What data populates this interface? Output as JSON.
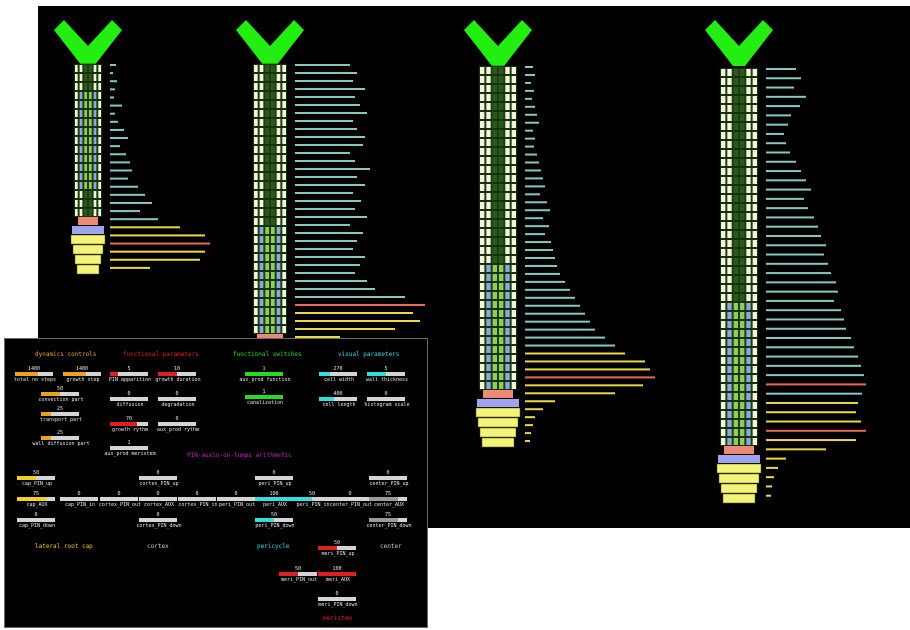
{
  "colors": {
    "sim_bg": "#000000",
    "v_tip": "#22ee11",
    "cell_fill": "#f2f7dc",
    "cell_green": "#8fcc5a",
    "cell_blue": "#8aa8dd",
    "cell_pink": "#ee8877",
    "meristem_band": "#a0a4ee",
    "cap": "#f4f47a",
    "bar_teal": "#88c7c0",
    "bar_yellow": "#e8d84a",
    "bar_red": "#ee6655",
    "orange": "#f0a020",
    "red": "#e02020",
    "green": "#22dd22",
    "cyan": "#33dddd",
    "white_fill": "#d4d4d4",
    "gray": "#999999",
    "magenta": "#cc22cc"
  },
  "roots": [
    {
      "name": "root-stage-1",
      "upper_cells": 8,
      "lower_cells": 9,
      "cap_layers": 4,
      "highlight_from": 3,
      "highlight_to": 14,
      "histogram": [
        6,
        3,
        7,
        5,
        4,
        12,
        5,
        8,
        14,
        18,
        10,
        16,
        20,
        22,
        18,
        28,
        35,
        42,
        30,
        48,
        70,
        95,
        100,
        95,
        90,
        40
      ]
    },
    {
      "name": "root-stage-2",
      "upper_cells": 10,
      "lower_cells": 20,
      "cap_layers": 4,
      "highlight_from": 18,
      "highlight_to": 30,
      "histogram": [
        55,
        62,
        58,
        70,
        60,
        65,
        72,
        58,
        62,
        70,
        68,
        55,
        60,
        75,
        62,
        70,
        58,
        66,
        60,
        72,
        55,
        68,
        62,
        58,
        70,
        65,
        60,
        72,
        80,
        110,
        130,
        118,
        125,
        100,
        45,
        20,
        12,
        8,
        6,
        4,
        3
      ]
    },
    {
      "name": "root-stage-3",
      "upper_cells": 14,
      "lower_cells": 22,
      "cap_layers": 4,
      "highlight_from": 22,
      "highlight_to": 36,
      "histogram": [
        8,
        10,
        6,
        9,
        7,
        10,
        12,
        14,
        8,
        10,
        9,
        12,
        14,
        16,
        18,
        20,
        15,
        22,
        25,
        18,
        24,
        20,
        26,
        28,
        30,
        32,
        35,
        40,
        45,
        50,
        55,
        60,
        65,
        70,
        80,
        90,
        100,
        120,
        125,
        130,
        118,
        90,
        30,
        18,
        10,
        8,
        6,
        5
      ]
    },
    {
      "name": "root-stage-4",
      "upper_cells": 16,
      "lower_cells": 26,
      "cap_layers": 4,
      "highlight_from": 26,
      "highlight_to": 42,
      "histogram": [
        30,
        35,
        28,
        40,
        34,
        25,
        22,
        18,
        20,
        24,
        30,
        35,
        40,
        45,
        38,
        42,
        48,
        52,
        55,
        60,
        58,
        62,
        65,
        70,
        72,
        68,
        75,
        78,
        80,
        85,
        88,
        92,
        95,
        98,
        100,
        96,
        92,
        90,
        95,
        100,
        90,
        60,
        20,
        12,
        8,
        6,
        5
      ]
    }
  ],
  "panel": {
    "headers": [
      {
        "text": "dynamics controls",
        "color": "#f0a020"
      },
      {
        "text": "functional parameters",
        "color": "#e02020"
      },
      {
        "text": "functional switches",
        "color": "#22dd22"
      },
      {
        "text": "visual parameters",
        "color": "#33dddd"
      },
      {
        "text": "PIN-auxin-on-lumps arithmetic",
        "color": "#cc22cc"
      },
      {
        "text": "lateral root cap",
        "color": "#f0d020"
      },
      {
        "text": "cortex",
        "color": "#cccccc"
      },
      {
        "text": "pericycle",
        "color": "#33dddd"
      },
      {
        "text": "center",
        "color": "#cccccc"
      },
      {
        "text": "meristem",
        "color": "#e02020"
      }
    ],
    "sliders": [
      {
        "name": "total-no-steps-slider",
        "label": "total no steps",
        "value": "1480",
        "color": "#f0a020",
        "fill": 0.6
      },
      {
        "name": "growth-step-slider",
        "label": "growth step",
        "value": "1480",
        "color": "#f0a020",
        "fill": 0.6
      },
      {
        "name": "convection-part-slider",
        "label": "convection part",
        "value": "50",
        "color": "#f0a020",
        "fill": 0.5
      },
      {
        "name": "transport-part-slider",
        "label": "transport part",
        "value": "25",
        "color": "#f0a020",
        "fill": 0.25
      },
      {
        "name": "wall-diffusion-part-slider",
        "label": "wall diffusion part",
        "value": "25",
        "color": "#f0a020",
        "fill": 0.25
      },
      {
        "name": "pin-apparition-slider",
        "label": "PIN apparition",
        "value": "5",
        "color": "#e02020",
        "fill": 0.2
      },
      {
        "name": "growth-duration-slider",
        "label": "growth duration",
        "value": "10",
        "color": "#e02020",
        "fill": 0.5
      },
      {
        "name": "diffusion-slider",
        "label": "diffusion",
        "value": "0",
        "color": "#e02020",
        "fill": 0
      },
      {
        "name": "degradation-slider",
        "label": "degradation",
        "value": "0",
        "color": "#e02020",
        "fill": 0
      },
      {
        "name": "growth-rythm-slider",
        "label": "growth rythm",
        "value": "70",
        "color": "#e02020",
        "fill": 0.7
      },
      {
        "name": "aux-prod-rythm-slider",
        "label": "aux_prod rythm",
        "value": "0",
        "color": "#e02020",
        "fill": 0
      },
      {
        "name": "aux-prod-meristem-slider",
        "label": "aux_prod meristem",
        "value": "1",
        "color": "#e02020",
        "fill": 0
      },
      {
        "name": "aux-prod-function-slider",
        "label": "aux_prod function",
        "value": "1",
        "color": "#22dd22",
        "fill": 1
      },
      {
        "name": "canalization-slider",
        "label": "canalization",
        "value": "1",
        "color": "#22dd22",
        "fill": 1
      },
      {
        "name": "cell-width-slider",
        "label": "cell width",
        "value": "270",
        "color": "#33dddd",
        "fill": 0.3
      },
      {
        "name": "wall-thickness-slider",
        "label": "wall thickness",
        "value": "5",
        "color": "#33dddd",
        "fill": 0.5
      },
      {
        "name": "cell-length-slider",
        "label": "cell length",
        "value": "400",
        "color": "#33dddd",
        "fill": 0.4
      },
      {
        "name": "histogram-scale-slider",
        "label": "histogram scale",
        "value": "0",
        "color": "#33dddd",
        "fill": 0
      },
      {
        "name": "cap-pin-up-slider",
        "label": "cap_PIN_up",
        "value": "50",
        "color": "#f0d020",
        "fill": 0.5
      },
      {
        "name": "cap-aux-slider",
        "label": "cap_AUX",
        "value": "75",
        "color": "#f0d020",
        "fill": 0.75
      },
      {
        "name": "cap-pin-in-slider",
        "label": "cap_PIN_in",
        "value": "0",
        "color": "#f0d020",
        "fill": 0
      },
      {
        "name": "cap-pin-down-slider",
        "label": "cap_PIN_down",
        "value": "0",
        "color": "#f0d020",
        "fill": 0
      },
      {
        "name": "cortex-pin-up-slider",
        "label": "cortex_PIN_up",
        "value": "0",
        "color": "#d4d4d4",
        "fill": 0
      },
      {
        "name": "cortex-pin-out-slider",
        "label": "cortex_PIN_out",
        "value": "0",
        "color": "#d4d4d4",
        "fill": 0
      },
      {
        "name": "cortex-aux-slider",
        "label": "cortex_AUX",
        "value": "0",
        "color": "#d4d4d4",
        "fill": 0
      },
      {
        "name": "cortex-pin-in-slider",
        "label": "cortex_PIN_in",
        "value": "0",
        "color": "#d4d4d4",
        "fill": 0
      },
      {
        "name": "cortex-pin-down-slider",
        "label": "cortex_PIN_down",
        "value": "0",
        "color": "#d4d4d4",
        "fill": 0
      },
      {
        "name": "peri-pin-out-top-slider",
        "label": "peri_PIN_out",
        "value": "0",
        "color": "#d4d4d4",
        "fill": 0
      },
      {
        "name": "peri-pin-up-slider",
        "label": "peri_PIN_up",
        "value": "0",
        "color": "#33dddd",
        "fill": 0
      },
      {
        "name": "peri-aux-slider",
        "label": "peri_AUX",
        "value": "100",
        "color": "#33dddd",
        "fill": 1
      },
      {
        "name": "peri-pin-in-slider",
        "label": "peri_PIN_in",
        "value": "50",
        "color": "#33dddd",
        "fill": 0.5
      },
      {
        "name": "peri-pin-down-slider",
        "label": "peri_PIN_down",
        "value": "50",
        "color": "#33dddd",
        "fill": 0.5
      },
      {
        "name": "center-pin-out-slider",
        "label": "center_PIN_out",
        "value": "0",
        "color": "#999999",
        "fill": 0
      },
      {
        "name": "center-pin-up-slider",
        "label": "center_PIN_up",
        "value": "0",
        "color": "#999999",
        "fill": 0
      },
      {
        "name": "center-aux-slider",
        "label": "center_AUX",
        "value": "75",
        "color": "#999999",
        "fill": 0.75
      },
      {
        "name": "center-pin-down-slider",
        "label": "center_PIN_down",
        "value": "75",
        "color": "#999999",
        "fill": 0.75
      },
      {
        "name": "meri-pin-up-slider",
        "label": "meri_PIN_up",
        "value": "50",
        "color": "#e02020",
        "fill": 0.5
      },
      {
        "name": "meri-pin-out-slider",
        "label": "meri_PIN_out",
        "value": "50",
        "color": "#e02020",
        "fill": 0.5
      },
      {
        "name": "meri-aux-slider",
        "label": "meri_AUX",
        "value": "100",
        "color": "#e02020",
        "fill": 1
      },
      {
        "name": "meri-pin-down-slider",
        "label": "meri_PIN_down",
        "value": "0",
        "color": "#e02020",
        "fill": 0
      }
    ]
  }
}
